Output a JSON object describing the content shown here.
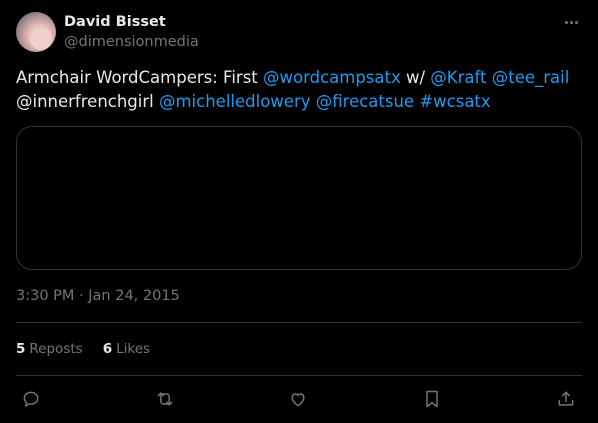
{
  "author": {
    "name": "David Bisset",
    "handle": "@dimensionmedia"
  },
  "tweet": {
    "parts": [
      {
        "text": "Armchair WordCampers: First ",
        "mention": false
      },
      {
        "text": "@wordcampsatx",
        "mention": true
      },
      {
        "text": " w/ ",
        "mention": false
      },
      {
        "text": "@Kraft",
        "mention": true
      },
      {
        "text": " ",
        "mention": false
      },
      {
        "text": "@tee_rail",
        "mention": true
      },
      {
        "text": " ",
        "mention": false
      },
      {
        "text": "@innerfrenchgirl",
        "mention": false
      },
      {
        "text": " ",
        "mention": false
      },
      {
        "text": "@michelledlowery",
        "mention": true
      },
      {
        "text": " ",
        "mention": false
      },
      {
        "text": "@firecatsue",
        "mention": true
      },
      {
        "text": " ",
        "mention": false
      },
      {
        "text": "#wcsatx",
        "mention": true
      }
    ],
    "timestamp": "3:30 PM · Jan 24, 2015"
  },
  "stats": {
    "reposts_count": "5",
    "reposts_label": "Reposts",
    "likes_count": "6",
    "likes_label": "Likes"
  },
  "colors": {
    "accent": "#1d9bf0",
    "muted": "#71767b",
    "text": "#e7e9ea",
    "border": "#2f3336"
  },
  "icons": [
    "more-icon",
    "reply-icon",
    "repost-icon",
    "like-icon",
    "bookmark-icon",
    "share-icon"
  ]
}
